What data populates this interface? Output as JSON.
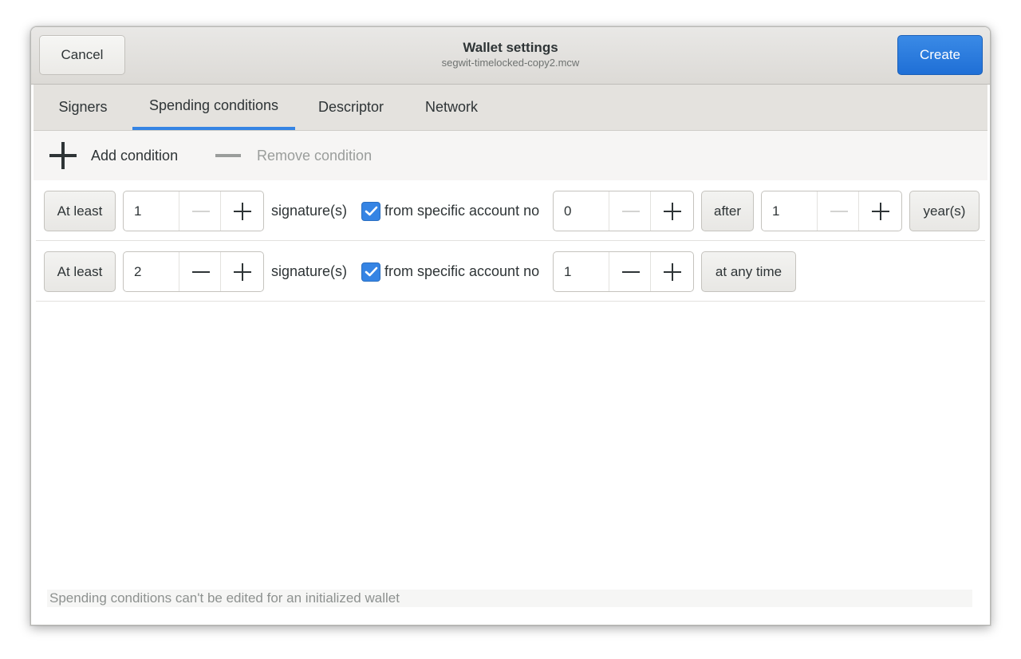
{
  "header": {
    "cancel_label": "Cancel",
    "title": "Wallet settings",
    "subtitle": "segwit-timelocked-copy2.mcw",
    "create_label": "Create"
  },
  "tabs": [
    {
      "label": "Signers",
      "active": false
    },
    {
      "label": "Spending conditions",
      "active": true
    },
    {
      "label": "Descriptor",
      "active": false
    },
    {
      "label": "Network",
      "active": false
    }
  ],
  "toolbar": {
    "add_label": "Add condition",
    "remove_label": "Remove condition"
  },
  "conditions": [
    {
      "at_least_label": "At least",
      "signatures_value": "1",
      "signatures_label": "signature(s)",
      "from_account_checked": true,
      "from_account_label": "from specific account no",
      "account_value": "0",
      "timing_label": "after",
      "timelock_value": "1",
      "timelock_unit_label": "year(s)"
    },
    {
      "at_least_label": "At least",
      "signatures_value": "2",
      "signatures_label": "signature(s)",
      "from_account_checked": true,
      "from_account_label": "from specific account no",
      "account_value": "1",
      "timing_label": "at any time"
    }
  ],
  "footer": {
    "message": "Spending conditions can't be edited for an initialized wallet"
  },
  "colors": {
    "accent": "#3584e4",
    "create_button": "#1f6fd6",
    "disabled_text": "#9a9d9b"
  }
}
